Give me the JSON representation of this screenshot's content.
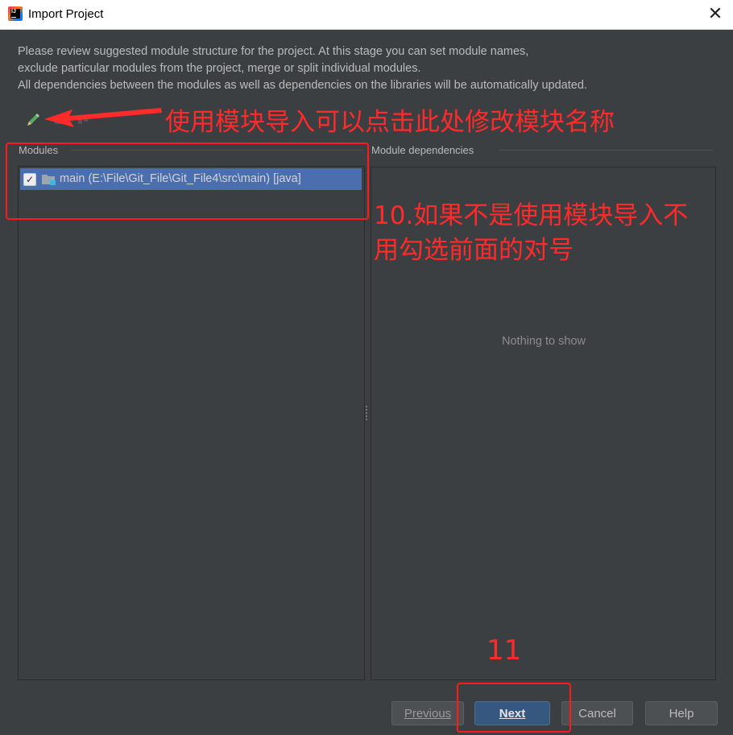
{
  "window": {
    "title": "Import Project",
    "close_glyph": "✕",
    "app_icon": "intellij-idea-icon",
    "app_icon_text": "IJ"
  },
  "description": {
    "line1": "Please review suggested module structure for the project. At this stage you can set module names,",
    "line2": "exclude particular modules from the project, merge or split individual modules.",
    "line3": "All dependencies between the modules as well as dependencies on the libraries will be automatically updated."
  },
  "toolbar": {
    "icons": [
      "rename-pencil-icon",
      "merge-icon",
      "split-icon"
    ]
  },
  "modules": {
    "label": "Modules",
    "items": [
      {
        "checked": true,
        "check_glyph": "✓",
        "label": "main (E:\\File\\Git_File\\Git_File4\\src\\main) [java]",
        "icon": "module-folder-icon"
      }
    ]
  },
  "dependencies": {
    "label": "Module dependencies",
    "empty_text": "Nothing to show"
  },
  "buttons": {
    "previous": "Previous",
    "next": "Next",
    "cancel": "Cancel",
    "help": "Help"
  },
  "annotations": {
    "rename_hint": "使用模块导入可以点击此处修改模块名称",
    "step10_line1": "10.如果不是使用模块导入不",
    "step10_line2": "用勾选前面的对号",
    "step11": "11"
  },
  "colors": {
    "dialog_bg": "#3c3f41",
    "selection": "#4b6eaf",
    "default_button": "#365880",
    "annotation_red": "#ff2a2a"
  }
}
